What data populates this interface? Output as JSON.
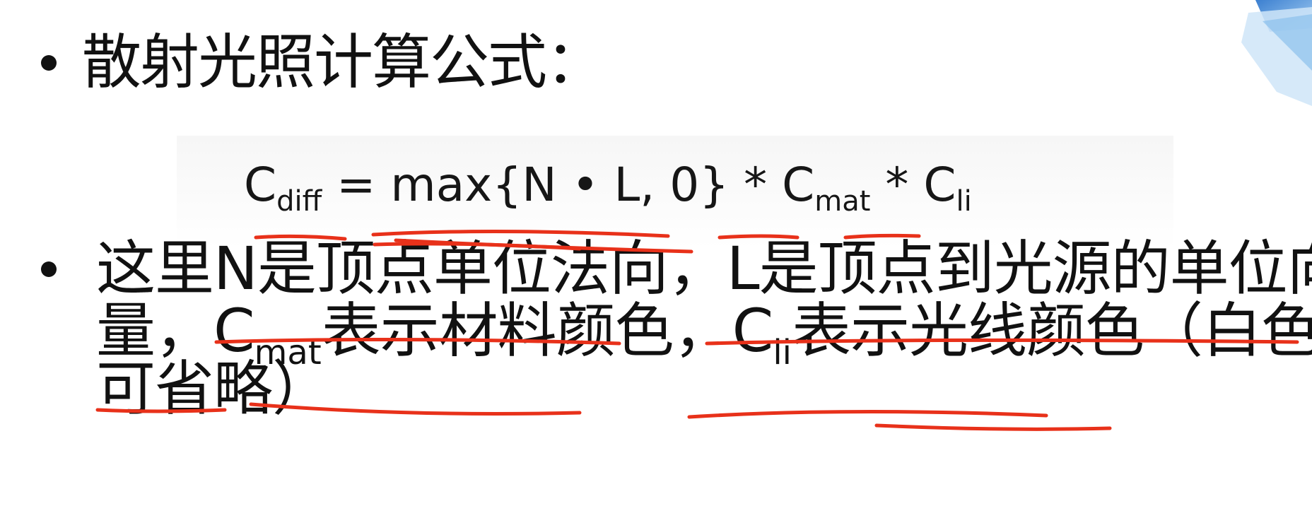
{
  "heading": {
    "text": "散射光照计算公式："
  },
  "formula": {
    "lhs": "C",
    "lhs_sub": "diff",
    "equals": " = ",
    "body": "max{N • L, 0} * ",
    "c_mat": "C",
    "c_mat_sub": "mat",
    "times": " * ",
    "c_li": "C",
    "c_li_sub": "li"
  },
  "description": {
    "line1": "这里N是顶点单位法向，L是顶点到光源的单位向",
    "line2_a": "量，C",
    "line2_sub_a": "mat",
    "line2_b": "表示材料颜色，C",
    "line2_sub_b": "li",
    "line2_c": "表示光线颜色（白色",
    "line3": "可省略）"
  },
  "colors": {
    "annotation": "#e8311a",
    "text": "#111111",
    "deco_blue": "#4a8fd4"
  }
}
